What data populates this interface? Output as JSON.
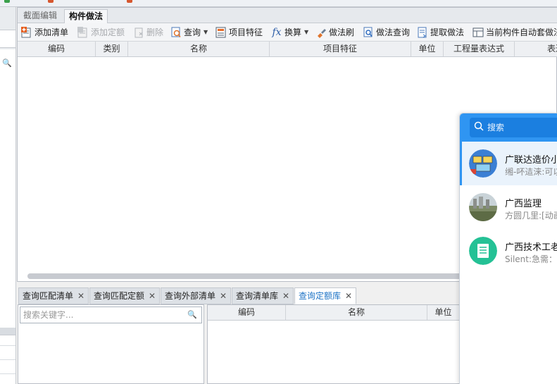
{
  "main_tabs": [
    {
      "label": "截面编辑",
      "active": false
    },
    {
      "label": "构件做法",
      "active": true
    }
  ],
  "toolbar": [
    {
      "label": "添加清单",
      "icon": "add-list-icon",
      "disabled": false
    },
    {
      "label": "添加定额",
      "icon": "add-quota-icon",
      "disabled": true
    },
    {
      "label": "删除",
      "icon": "delete-icon",
      "disabled": true
    },
    {
      "label": "查询",
      "icon": "query-icon",
      "disabled": false,
      "dropdown": true
    },
    {
      "label": "项目特征",
      "icon": "project-feature-icon",
      "disabled": false
    },
    {
      "label": "换算",
      "icon": "fx-icon",
      "disabled": false,
      "dropdown": true
    },
    {
      "label": "做法刷",
      "icon": "brush-icon",
      "disabled": false
    },
    {
      "label": "做法查询",
      "icon": "method-query-icon",
      "disabled": false
    },
    {
      "label": "提取做法",
      "icon": "extract-method-icon",
      "disabled": false
    },
    {
      "label": "当前构件自动套做法",
      "icon": "auto-apply-icon",
      "disabled": false
    }
  ],
  "grid_columns": [
    "编码",
    "类别",
    "名称",
    "项目特征",
    "单位",
    "工程量表达式",
    "表达"
  ],
  "bottom_tabs": [
    {
      "label": "查询匹配清单",
      "active": false
    },
    {
      "label": "查询匹配定额",
      "active": false
    },
    {
      "label": "查询外部清单",
      "active": false
    },
    {
      "label": "查询清单库",
      "active": false
    },
    {
      "label": "查询定额库",
      "active": true
    }
  ],
  "bottom_search_placeholder": "搜索关键字...",
  "bottom_columns": [
    "编码",
    "名称",
    "单位"
  ],
  "popup": {
    "search_placeholder": "搜索",
    "contacts": [
      {
        "name": "广联达造价小",
        "message": "缃-吥迼涞:可以",
        "selected": true,
        "avatar": "group-avatar-icon"
      },
      {
        "name": "广西监理",
        "message": "方圆几里:[动画",
        "selected": false,
        "avatar": "photo-avatar-icon"
      },
      {
        "name": "广西技术工老",
        "message": "Silent:急需：中",
        "selected": false,
        "avatar": "note-avatar-icon"
      }
    ]
  },
  "colors": {
    "accent": "#2f95f2",
    "active_tab_text": "#1d73c6",
    "disabled_text": "#a7a9ad"
  }
}
